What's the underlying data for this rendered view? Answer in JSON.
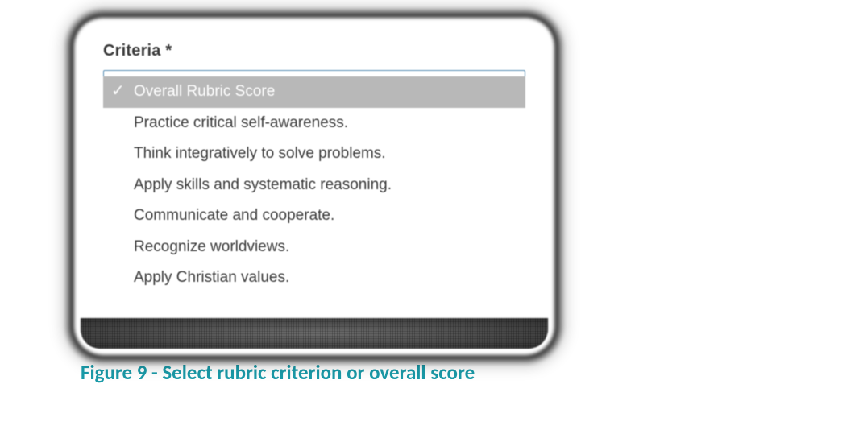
{
  "form": {
    "label": "Criteria *"
  },
  "dropdown": {
    "items": [
      {
        "label": "Overall Rubric Score",
        "selected": true
      },
      {
        "label": "Practice critical self-awareness.",
        "selected": false
      },
      {
        "label": "Think integratively to solve problems.",
        "selected": false
      },
      {
        "label": "Apply skills and systematic reasoning.",
        "selected": false
      },
      {
        "label": "Communicate and cooperate.",
        "selected": false
      },
      {
        "label": "Recognize worldviews.",
        "selected": false
      },
      {
        "label": "Apply Christian values.",
        "selected": false
      }
    ]
  },
  "caption": "Figure 9 - Select rubric criterion or overall score"
}
